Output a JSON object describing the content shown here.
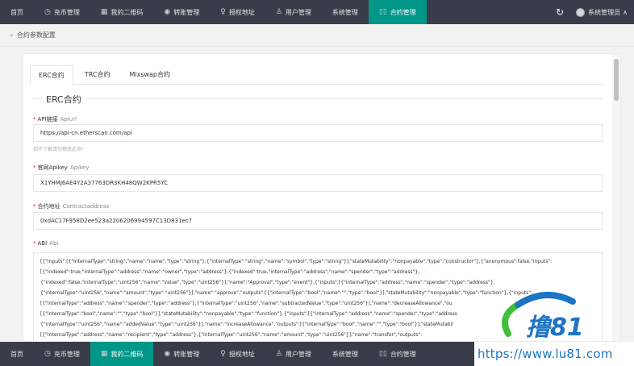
{
  "topnav": {
    "items": [
      {
        "label": "首页",
        "icon": ""
      },
      {
        "label": "充币管理",
        "icon": "clock-icon"
      },
      {
        "label": "我的二维码",
        "icon": "grid-icon"
      },
      {
        "label": "转账管理",
        "icon": "circle-icon"
      },
      {
        "label": "授权地址",
        "icon": "bulb-icon"
      },
      {
        "label": "用户管理",
        "icon": "user-icon"
      },
      {
        "label": "系统管理",
        "icon": ""
      },
      {
        "label": "合约管理",
        "icon": "columns-icon"
      }
    ],
    "active_index": 7,
    "refresh_glyph": "↻",
    "user_label": "系统管理员"
  },
  "bottomnav": {
    "items": [
      {
        "label": "首页"
      },
      {
        "label": "充币管理"
      },
      {
        "label": "我的二维码"
      },
      {
        "label": "转账管理"
      },
      {
        "label": "授权地址"
      },
      {
        "label": "用户管理"
      },
      {
        "label": "系统管理"
      },
      {
        "label": "合约管理"
      }
    ],
    "active_index": 2
  },
  "breadcrumb": {
    "sep": "»",
    "text": "合约参数配置"
  },
  "tabs": [
    "ERC合约",
    "TRC合约",
    "Mixswap合约"
  ],
  "section_title": "ERC合约",
  "fields": {
    "api": {
      "label": "API链接",
      "key": "Apiurl",
      "value": "https://api-cn.etherscan.com/api",
      "hint": "如不了解请勿修改此项!"
    },
    "apikey": {
      "label": "官网Apikey",
      "key": "Apikey",
      "value": "X1YHMJ6AE4Y2A37763DR3KH48QW2KPR5YC"
    },
    "contract": {
      "label": "合约地址",
      "key": "Contractaddress",
      "value": "0xdAC17F958D2ee523a2206206994597C13D831ec7"
    },
    "abi": {
      "label": "ABI",
      "key": "Abi",
      "lines": [
        "[{\"inputs\":[{\"internalType\":\"string\",\"name\":\"name\",\"type\":\"string\"},{\"internalType\":\"string\",\"name\":\"symbol\",\"type\":\"string\"}],\"stateMutability\":\"nonpayable\",\"type\":\"constructor\"},{\"anonymous\":false,\"inputs\":",
        "[{\"indexed\":true,\"internalType\":\"address\",\"name\":\"owner\",\"type\":\"address\"},{\"indexed\":true,\"internalType\":\"address\",\"name\":\"spender\",\"type\":\"address\"},",
        "{\"indexed\":false,\"internalType\":\"uint256\",\"name\":\"value\",\"type\":\"uint256\"}],\"name\":\"Approval\",\"type\":\"event\"},{\"inputs\":[{\"internalType\":\"address\",\"name\":\"spender\",\"type\":\"address\"},",
        "{\"internalType\":\"uint256\",\"name\":\"amount\",\"type\":\"uint256\"}],\"name\":\"approve\",\"outputs\":[{\"internalType\":\"bool\",\"name\":\"\",\"type\":\"bool\"}],\"stateMutability\":\"nonpayable\",\"type\":\"function\"},{\"inputs\":",
        "[{\"internalType\":\"address\",\"name\":\"spender\",\"type\":\"address\"},{\"internalType\":\"uint256\",\"name\":\"subtractedValue\",\"type\":\"uint256\"}],\"name\":\"decreaseAllowance\",\"ou",
        "[{\"internalType\":\"bool\",\"name\":\"\",\"type\":\"bool\"}],\"stateMutability\":\"nonpayable\",\"type\":\"function\"},{\"inputs\":[{\"internalType\":\"address\",\"name\":\"spender\",\"type\":\"address",
        "{\"internalType\":\"uint256\",\"name\":\"addedValue\",\"type\":\"uint256\"}],\"name\":\"increaseAllowance\",\"outputs\":[{\"internalType\":\"bool\",\"name\":\"\",\"type\":\"bool\"}],\"stateMutabil",
        "[{\"internalType\":\"address\",\"name\":\"recipient\",\"type\":\"address\"},{\"internalType\":\"uint256\",\"name\":\"amount\",\"type\":\"uint256\"}],\"name\":\"transfer\",\"outputs\":"
      ]
    }
  },
  "watermark": {
    "url": "https://www.lu81.com",
    "logo_text": "撸81",
    "colors": {
      "blue": "#1c74c4",
      "green": "#3fbf3a"
    }
  },
  "colors": {
    "nav_bg": "#393d49",
    "active": "#009688",
    "required": "#e02020"
  }
}
